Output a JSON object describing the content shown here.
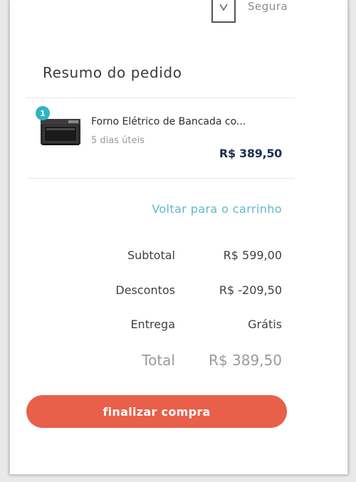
{
  "header": {
    "secure_label": "Segura",
    "secure_icon": "shield-check-icon"
  },
  "summary": {
    "title": "Resumo do pedido"
  },
  "items": [
    {
      "quantity": "1",
      "name": "Forno Elétrico de Bancada co...",
      "delivery": "5 dias úteis",
      "price": "R$ 389,50",
      "thumbnail_icon": "oven-product-image"
    }
  ],
  "back_to_cart": "Voltar para o carrinho",
  "totals": {
    "subtotal_label": "Subtotal",
    "subtotal_value": "R$ 599,00",
    "discounts_label": "Descontos",
    "discounts_value": "R$ -209,50",
    "shipping_label": "Entrega",
    "shipping_value": "Grátis",
    "total_label": "Total",
    "total_value": "R$ 389,50"
  },
  "checkout": {
    "button_label": "finalizar compra"
  },
  "colors": {
    "accent_button": "#e8604a",
    "link": "#5fb9cc",
    "badge": "#2fb5c4",
    "price": "#1e2f4f"
  }
}
